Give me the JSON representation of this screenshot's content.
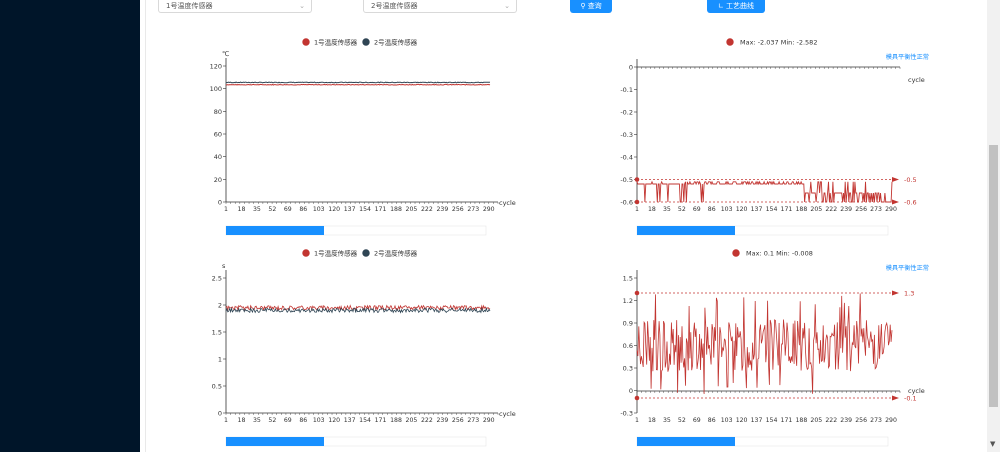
{
  "filters": {
    "sensor1": "1号温度传感器",
    "sensor2": "2号温度传感器",
    "query_label": "查询",
    "process_curve_label": "工艺曲线"
  },
  "colors": {
    "series1": "#c23531",
    "series2": "#2f4554",
    "accent": "#1890ff",
    "sidebar": "#001529"
  },
  "icons": {
    "query": "search-icon",
    "process": "line-chart-icon"
  },
  "charts": {
    "temp": {
      "legend": [
        "1号温度传感器",
        "2号温度传感器"
      ],
      "unit": "℃",
      "xname": "cycle",
      "yticks": [
        "120",
        "100",
        "80",
        "60",
        "40",
        "20",
        "0"
      ],
      "xticks": [
        "1",
        "18",
        "35",
        "52",
        "69",
        "86",
        "103",
        "120",
        "137",
        "154",
        "171",
        "188",
        "205",
        "222",
        "239",
        "256",
        "273",
        "290"
      ]
    },
    "time": {
      "legend": [
        "1号温度传感器",
        "2号温度传感器"
      ],
      "unit": "s",
      "xname": "cycle",
      "yticks": [
        "2.5",
        "2",
        "1.5",
        "1",
        "0.5",
        "0"
      ],
      "xticks": [
        "1",
        "18",
        "35",
        "52",
        "69",
        "86",
        "103",
        "120",
        "137",
        "154",
        "171",
        "188",
        "205",
        "222",
        "239",
        "256",
        "273",
        "290"
      ]
    },
    "diff": {
      "legend": "Max: -2.037 Min: -2.582",
      "status": "模具平衡性正常",
      "xname": "cycle",
      "yticks": [
        "0",
        "-0.1",
        "-0.2",
        "-0.3",
        "-0.4",
        "-0.5",
        "-0.6"
      ],
      "xticks": [
        "1",
        "18",
        "35",
        "52",
        "69",
        "86",
        "103",
        "120",
        "137",
        "154",
        "171",
        "188",
        "205",
        "222",
        "239",
        "256",
        "273",
        "290"
      ],
      "markers": [
        "-0.5",
        "-0.6"
      ]
    },
    "diff2": {
      "legend": "Max: 0.1 Min: -0.008",
      "status": "模具平衡性正常",
      "xname": "cycle",
      "yticks": [
        "1.5",
        "1.2",
        "0.9",
        "0.6",
        "0.3",
        "0",
        "-0.3"
      ],
      "xticks": [
        "1",
        "18",
        "35",
        "52",
        "69",
        "86",
        "103",
        "120",
        "137",
        "154",
        "171",
        "188",
        "205",
        "222",
        "239",
        "256",
        "273",
        "290"
      ],
      "markers": [
        "1.3",
        "-0.1"
      ]
    }
  },
  "chart_data": [
    {
      "type": "line",
      "title": "",
      "xlabel": "cycle",
      "ylabel": "℃",
      "ylim": [
        0,
        120
      ],
      "xlim": [
        1,
        300
      ],
      "series": [
        {
          "name": "1号温度传感器",
          "value_approx": 103.5
        },
        {
          "name": "2号温度传感器",
          "value_approx": 105.5
        }
      ],
      "legend": "top"
    },
    {
      "type": "line",
      "title": "",
      "xlabel": "cycle",
      "ylabel": "",
      "ylim": [
        -0.6,
        0
      ],
      "xlim": [
        1,
        300
      ],
      "series": [
        {
          "name": "Max: -2.037 Min: -2.582",
          "range": [
            -0.6,
            -0.5
          ]
        }
      ],
      "markLines": [
        -0.5,
        -0.6
      ],
      "legend": "top"
    },
    {
      "type": "line",
      "title": "",
      "xlabel": "cycle",
      "ylabel": "s",
      "ylim": [
        0,
        2.5
      ],
      "xlim": [
        1,
        300
      ],
      "series": [
        {
          "name": "1号温度传感器",
          "value_approx": 1.95
        },
        {
          "name": "2号温度传感器",
          "value_approx": 1.9
        }
      ],
      "legend": "top"
    },
    {
      "type": "line",
      "title": "",
      "xlabel": "cycle",
      "ylabel": "",
      "ylim": [
        -0.3,
        1.5
      ],
      "xlim": [
        1,
        300
      ],
      "series": [
        {
          "name": "Max: 0.1 Min: -0.008",
          "range": [
            -0.1,
            1.3
          ]
        }
      ],
      "markLines": [
        1.3,
        -0.1
      ],
      "legend": "top"
    }
  ]
}
